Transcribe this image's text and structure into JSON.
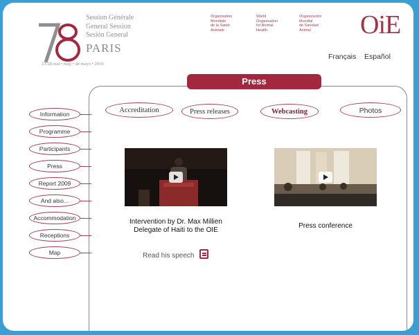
{
  "header": {
    "logo_number": "78",
    "session_lines": [
      "Session Générale",
      "General Session",
      "Sesión General"
    ],
    "city": "PARIS",
    "dates": "23-28 mai • may • de mayo • 2010",
    "org_fr": [
      "Organisation",
      "Mondiale",
      "de la Santé",
      "Animale"
    ],
    "org_en": [
      "World",
      "Organisation",
      "for Animal",
      "Health"
    ],
    "org_es": [
      "Organización",
      "Mundial",
      "de Sanidad",
      "Animal"
    ],
    "brand": "OiE",
    "lang_fr": "Français",
    "lang_es": "Español"
  },
  "page_title": "Press",
  "tabs": [
    "Accreditation",
    "Press releases",
    "Webcasting",
    "Photos"
  ],
  "active_tab": "Webcasting",
  "sidebar": [
    "Information",
    "Programme",
    "Participants",
    "Press",
    "Report 2009",
    "And also...",
    "Accommodation",
    "Receptions",
    "Map"
  ],
  "videos": [
    {
      "caption_1": "Intervention by Dr. Max Millien",
      "caption_2": "Delegate of Haiti to the OIE",
      "link": "Read his speech"
    },
    {
      "caption_1": "Press conference"
    }
  ],
  "colors": {
    "accent": "#a3283f",
    "background": "#3b9fd6"
  }
}
